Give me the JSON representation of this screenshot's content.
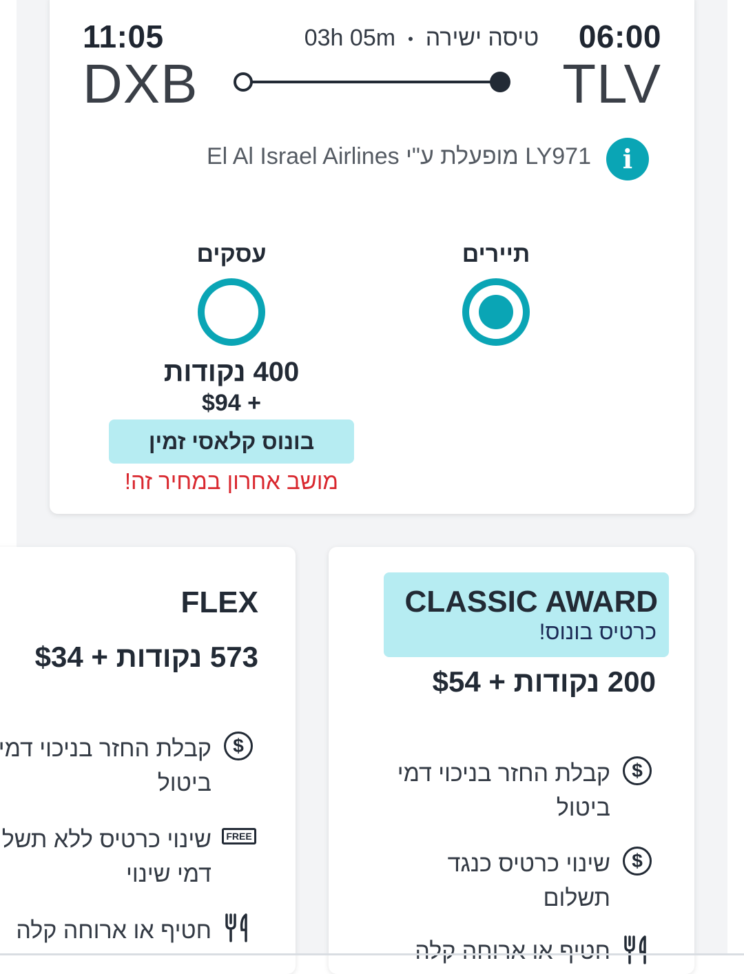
{
  "flight": {
    "arrival_time": "11:05",
    "arrival_code": "DXB",
    "departure_time": "06:00",
    "departure_code": "TLV",
    "duration": "03h 05m",
    "stop_type": "טיסה ישירה",
    "operator_text": "LY971 מופעלת ע\"י El Al Israel Airlines"
  },
  "cabins": {
    "economy_label": "תיירים",
    "business_label": "עסקים",
    "selected": "economy",
    "business_points": "400 נקודות",
    "business_cash": "+ $94",
    "business_button": "בונוס קלאסי זמין",
    "business_warning": "מושב אחרון במחיר זה!"
  },
  "fares": {
    "flex": {
      "name": "FLEX",
      "price": "573 נקודות + $34",
      "features": [
        {
          "icon": "dollar-icon",
          "text": "קבלת החזר בניכוי דמי ביטול"
        },
        {
          "icon": "free-icon",
          "text": "שינוי כרטיס ללא תשלום דמי שינוי"
        },
        {
          "icon": "meal-icon",
          "text": "חטיף או ארוחה קלה"
        }
      ]
    },
    "classic": {
      "name": "CLASSIC AWARD",
      "subtitle": "כרטיס בונוס!",
      "price": "200 נקודות + $54",
      "features": [
        {
          "icon": "dollar-icon",
          "text": "קבלת החזר בניכוי דמי ביטול"
        },
        {
          "icon": "dollar-icon",
          "text": "שינוי כרטיס כנגד תשלום"
        },
        {
          "icon": "meal-icon",
          "text": "חטיף או ארוחה קלה"
        }
      ]
    },
    "free_icon_text": "FREE"
  },
  "colors": {
    "accent": "#0aa5b5",
    "banner": "#b6ecf2",
    "warning": "#d9272e",
    "text": "#222a35"
  }
}
